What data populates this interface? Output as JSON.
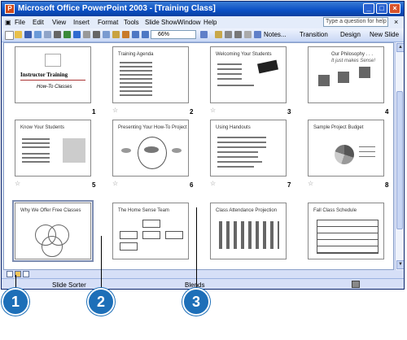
{
  "window": {
    "title": "Microsoft Office PowerPoint 2003 - [Training Class]"
  },
  "menu": [
    "File",
    "Edit",
    "View",
    "Insert",
    "Format",
    "Tools",
    "Slide Show",
    "Window",
    "Help"
  ],
  "help_placeholder": "Type a question for help",
  "toolbar": {
    "zoom": "66%",
    "notes": "Notes...",
    "transition": "Transition",
    "design": "Design",
    "new_slide": "New Slide"
  },
  "slides": [
    {
      "num": "1",
      "title": "Instructor Training",
      "sub": "How-To Classes"
    },
    {
      "num": "2",
      "title": "Training Agenda"
    },
    {
      "num": "3",
      "title": "Welcoming Your Students"
    },
    {
      "num": "4",
      "title": "Our Philosophy . . .",
      "sub": "It just makes Sense!"
    },
    {
      "num": "5",
      "title": "Know Your Students"
    },
    {
      "num": "6",
      "title": "Presenting Your How-To Project"
    },
    {
      "num": "7",
      "title": "Using Handouts"
    },
    {
      "num": "8",
      "title": "Sample Project Budget"
    },
    {
      "num": "",
      "title": "Why We Offer Free Classes"
    },
    {
      "num": "",
      "title": "The Home Sense Team"
    },
    {
      "num": "",
      "title": "Class Attendance Projection"
    },
    {
      "num": "",
      "title": "Fall Class Schedule"
    }
  ],
  "status": {
    "view": "Slide Sorter",
    "design": "Blends"
  },
  "callouts": [
    "1",
    "2",
    "3"
  ]
}
